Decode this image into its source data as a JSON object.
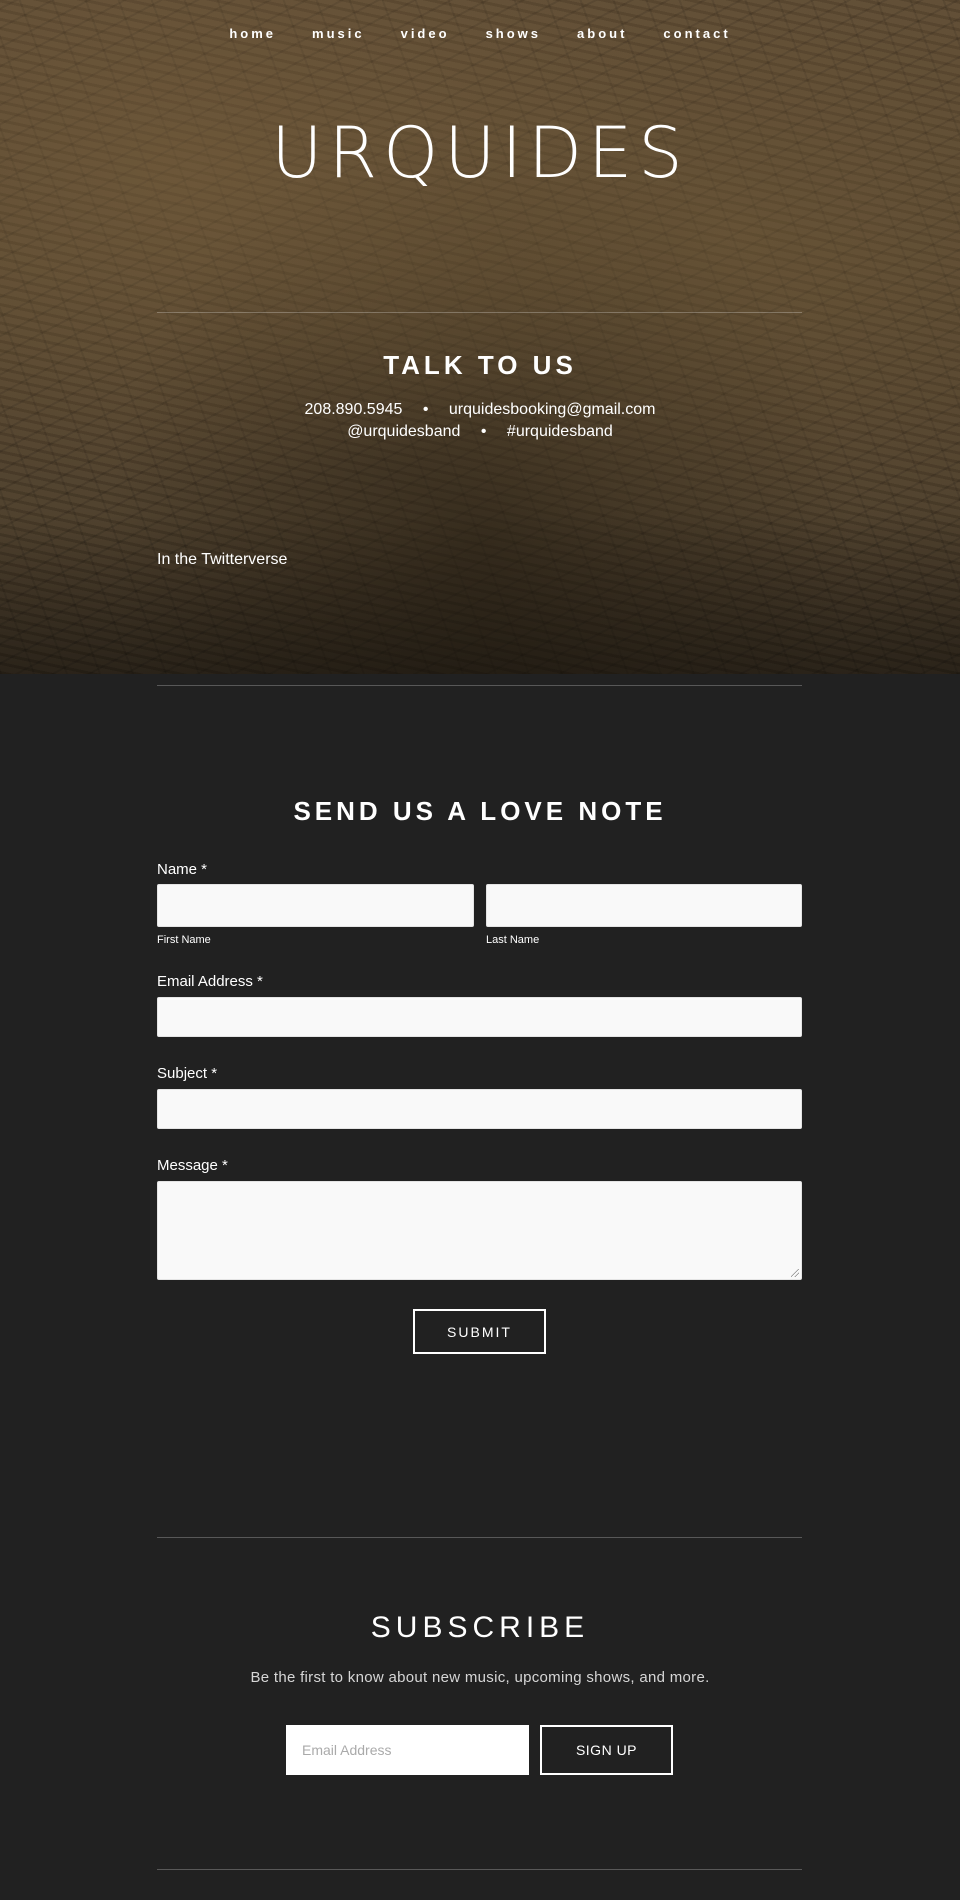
{
  "nav": {
    "items": [
      "home",
      "music",
      "video",
      "shows",
      "about",
      "contact"
    ]
  },
  "site": {
    "title": "URQUIDES"
  },
  "talk": {
    "title": "TALK TO US",
    "phone": "208.890.5945",
    "bullet": "•",
    "email": "urquidesbooking@gmail.com",
    "handle": "@urquidesband",
    "hashtag": "#urquidesband"
  },
  "twitter": {
    "heading": "In the Twitterverse"
  },
  "form": {
    "title": "SEND US A LOVE NOTE",
    "name_label": "Name *",
    "first_name_label": "First Name",
    "last_name_label": "Last Name",
    "email_label": "Email Address *",
    "subject_label": "Subject *",
    "message_label": "Message *",
    "submit_label": "SUBMIT"
  },
  "subscribe": {
    "title": "SUBSCRIBE",
    "description": "Be the first to know about new music, upcoming shows, and more.",
    "email_placeholder": "Email Address",
    "signup_label": "SIGN UP"
  },
  "colors": {
    "page_background": "#212121",
    "field_background": "#f9f9f9",
    "text": "#ffffff"
  }
}
